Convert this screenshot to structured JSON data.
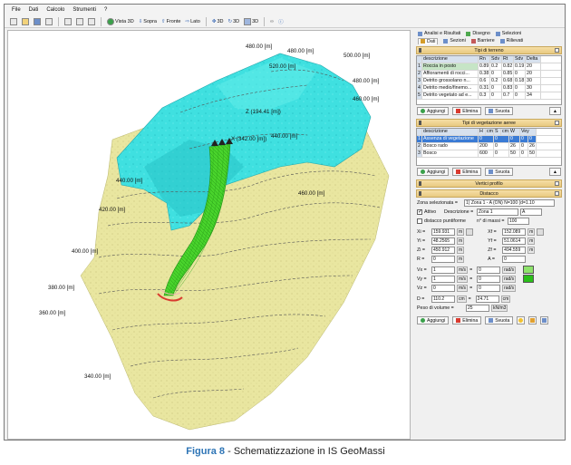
{
  "menu": [
    "File",
    "Dati",
    "Calcolo",
    "Strumenti",
    "?"
  ],
  "toolbar": {
    "vista3d": "Vista 3D",
    "sopra": "Sopra",
    "fronte": "Fronte",
    "lato": "Lato",
    "b3d1": "3D",
    "b3d2": "3D",
    "b3d3": "3D"
  },
  "viewport": {
    "labels": {
      "y480a": "480.00 [m]",
      "y480b": "480.00 [m]",
      "y500": "500.00 [m]",
      "y520": "520.00 [m]",
      "y480c": "480.00 [m]",
      "y460a": "460.00 [m]",
      "z": "Z (194.41 [m])",
      "x": "X (342.00 [m])",
      "y440a": "440.00 [m]",
      "y440b": "440.00 [m]",
      "y460b": "460.00 [m]",
      "y420": "420.00 [m]",
      "y400": "400.00 [m]",
      "y380": "380.00 [m]",
      "y360": "360.00 [m]",
      "y340": "340.00 [m]"
    },
    "colors": {
      "cliff": "#3fe0e0",
      "terrain": "#e9e6a0",
      "track": "#43d12a",
      "start": "#d93b2f"
    }
  },
  "panel": {
    "tabs": [
      "Analisi e Risultati",
      "Disegno",
      "Selezioni",
      "Dati",
      "Sezioni",
      "Barriere",
      "Rilievati"
    ],
    "terreno": {
      "title": "Tipi di terreno",
      "headers": [
        "descrizione",
        "Rn",
        "Sdv",
        "Rt",
        "Sdv",
        "Delta"
      ],
      "rows": [
        [
          "1",
          "Roccia in posto",
          "0.89",
          "0.2",
          "0.82",
          "0.19",
          "20"
        ],
        [
          "2",
          "Affioramenti di rocci...",
          "0.38",
          "0",
          "0.85",
          "0",
          "20"
        ],
        [
          "3",
          "Detrito grossolano n...",
          "0.6",
          "0.2",
          "0.68",
          "0.18",
          "30"
        ],
        [
          "4",
          "Detrito medio/finemo...",
          "0.31",
          "0",
          "0.83",
          "0",
          "30"
        ],
        [
          "5",
          "Detrito vegetato ad e...",
          "0.3",
          "0",
          "0.7",
          "0",
          "34"
        ]
      ]
    },
    "buttons": {
      "aggiungi": "Aggiungi",
      "elimina": "Elimina",
      "svuota": "Svuota"
    },
    "vegetazione": {
      "title": "Tipi di vegetazione aeree",
      "headers": [
        "descrizione",
        "H",
        "cm",
        "S",
        "cm",
        "W",
        "Vey"
      ],
      "rows": [
        [
          "1",
          "Assenza di vegetazione",
          "0",
          "0",
          "0",
          "0",
          "0"
        ],
        [
          "2",
          "Bosco rado",
          "200",
          "0",
          "26",
          "0",
          "26"
        ],
        [
          "3",
          "Bosco",
          "600",
          "0",
          "50",
          "0",
          "50"
        ]
      ]
    },
    "vertici": "Vertici profilo",
    "distacco": {
      "title": "Distacco",
      "zona_label": "Zona selezionata =",
      "zona_value": "1) Zona 1 - A   (ON) N=100 (d=1.10",
      "attivo": "Attivo",
      "descrizione_label": "Descrizione =",
      "descrizione_value": "Zona 1",
      "descrizione_code": "A",
      "puntiforme": "distacco puntiforme",
      "masse_label": "n° di massi =",
      "masse_value": "100",
      "xi_label": "Xi =",
      "xi": "159.931",
      "yi_label": "Yi =",
      "yi": "48.2565",
      "zi_label": "Zi =",
      "zi": "450.912",
      "r_label": "R =",
      "r": "0",
      "xf_label": "Xf =",
      "xf": "152.089",
      "yf_label": "Yf =",
      "yf": "51.0614",
      "zf_label": "Zf =",
      "zf": "494.559",
      "a_label": "A =",
      "a": "0",
      "vx_label": "Vx =",
      "vx": "1",
      "vx2": "0",
      "vy_label": "Vy =",
      "vy": "1",
      "vy2": "0",
      "vz_label": "Vz =",
      "vz": "0",
      "vz2": "0",
      "unit_m": "m",
      "unit_ms": "m/s",
      "unit_rads": "rad/s",
      "d_label": "D =",
      "d": "110.2",
      "d2": "24.71",
      "unit_cm": "cm",
      "peso_label": "Peso di volume =",
      "peso": "25",
      "unit_peso": "kN/m3"
    }
  },
  "caption": {
    "fig": "Figura 8",
    "text": " - Schematizzazione in IS GeoMassi"
  }
}
